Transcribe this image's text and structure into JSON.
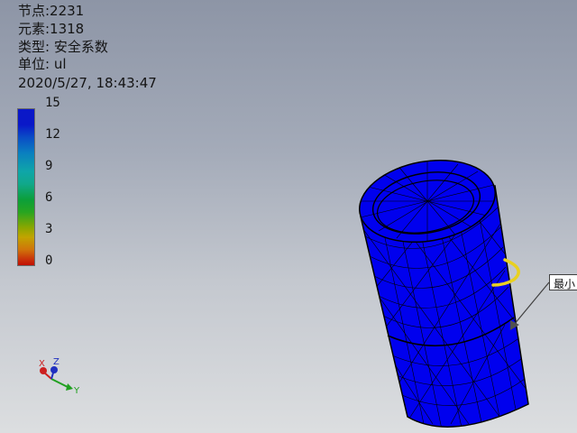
{
  "info": {
    "nodes": "节点:2231",
    "elements": "元素:1318",
    "type": "类型: 安全系数",
    "unit": "单位: ul",
    "datetime": "2020/5/27, 18:43:47"
  },
  "legend": {
    "ticks": [
      "15",
      "12",
      "9",
      "6",
      "3",
      "0"
    ],
    "max_color": "#0a18c8",
    "min_color": "#c01000"
  },
  "model": {
    "color": "#0000ee",
    "mesh_color": "#000000",
    "marker_color": "#e8d020"
  },
  "callout": {
    "label": "最小"
  },
  "triad": {
    "x_label": "X",
    "y_label": "Y",
    "z_label": "Z"
  }
}
